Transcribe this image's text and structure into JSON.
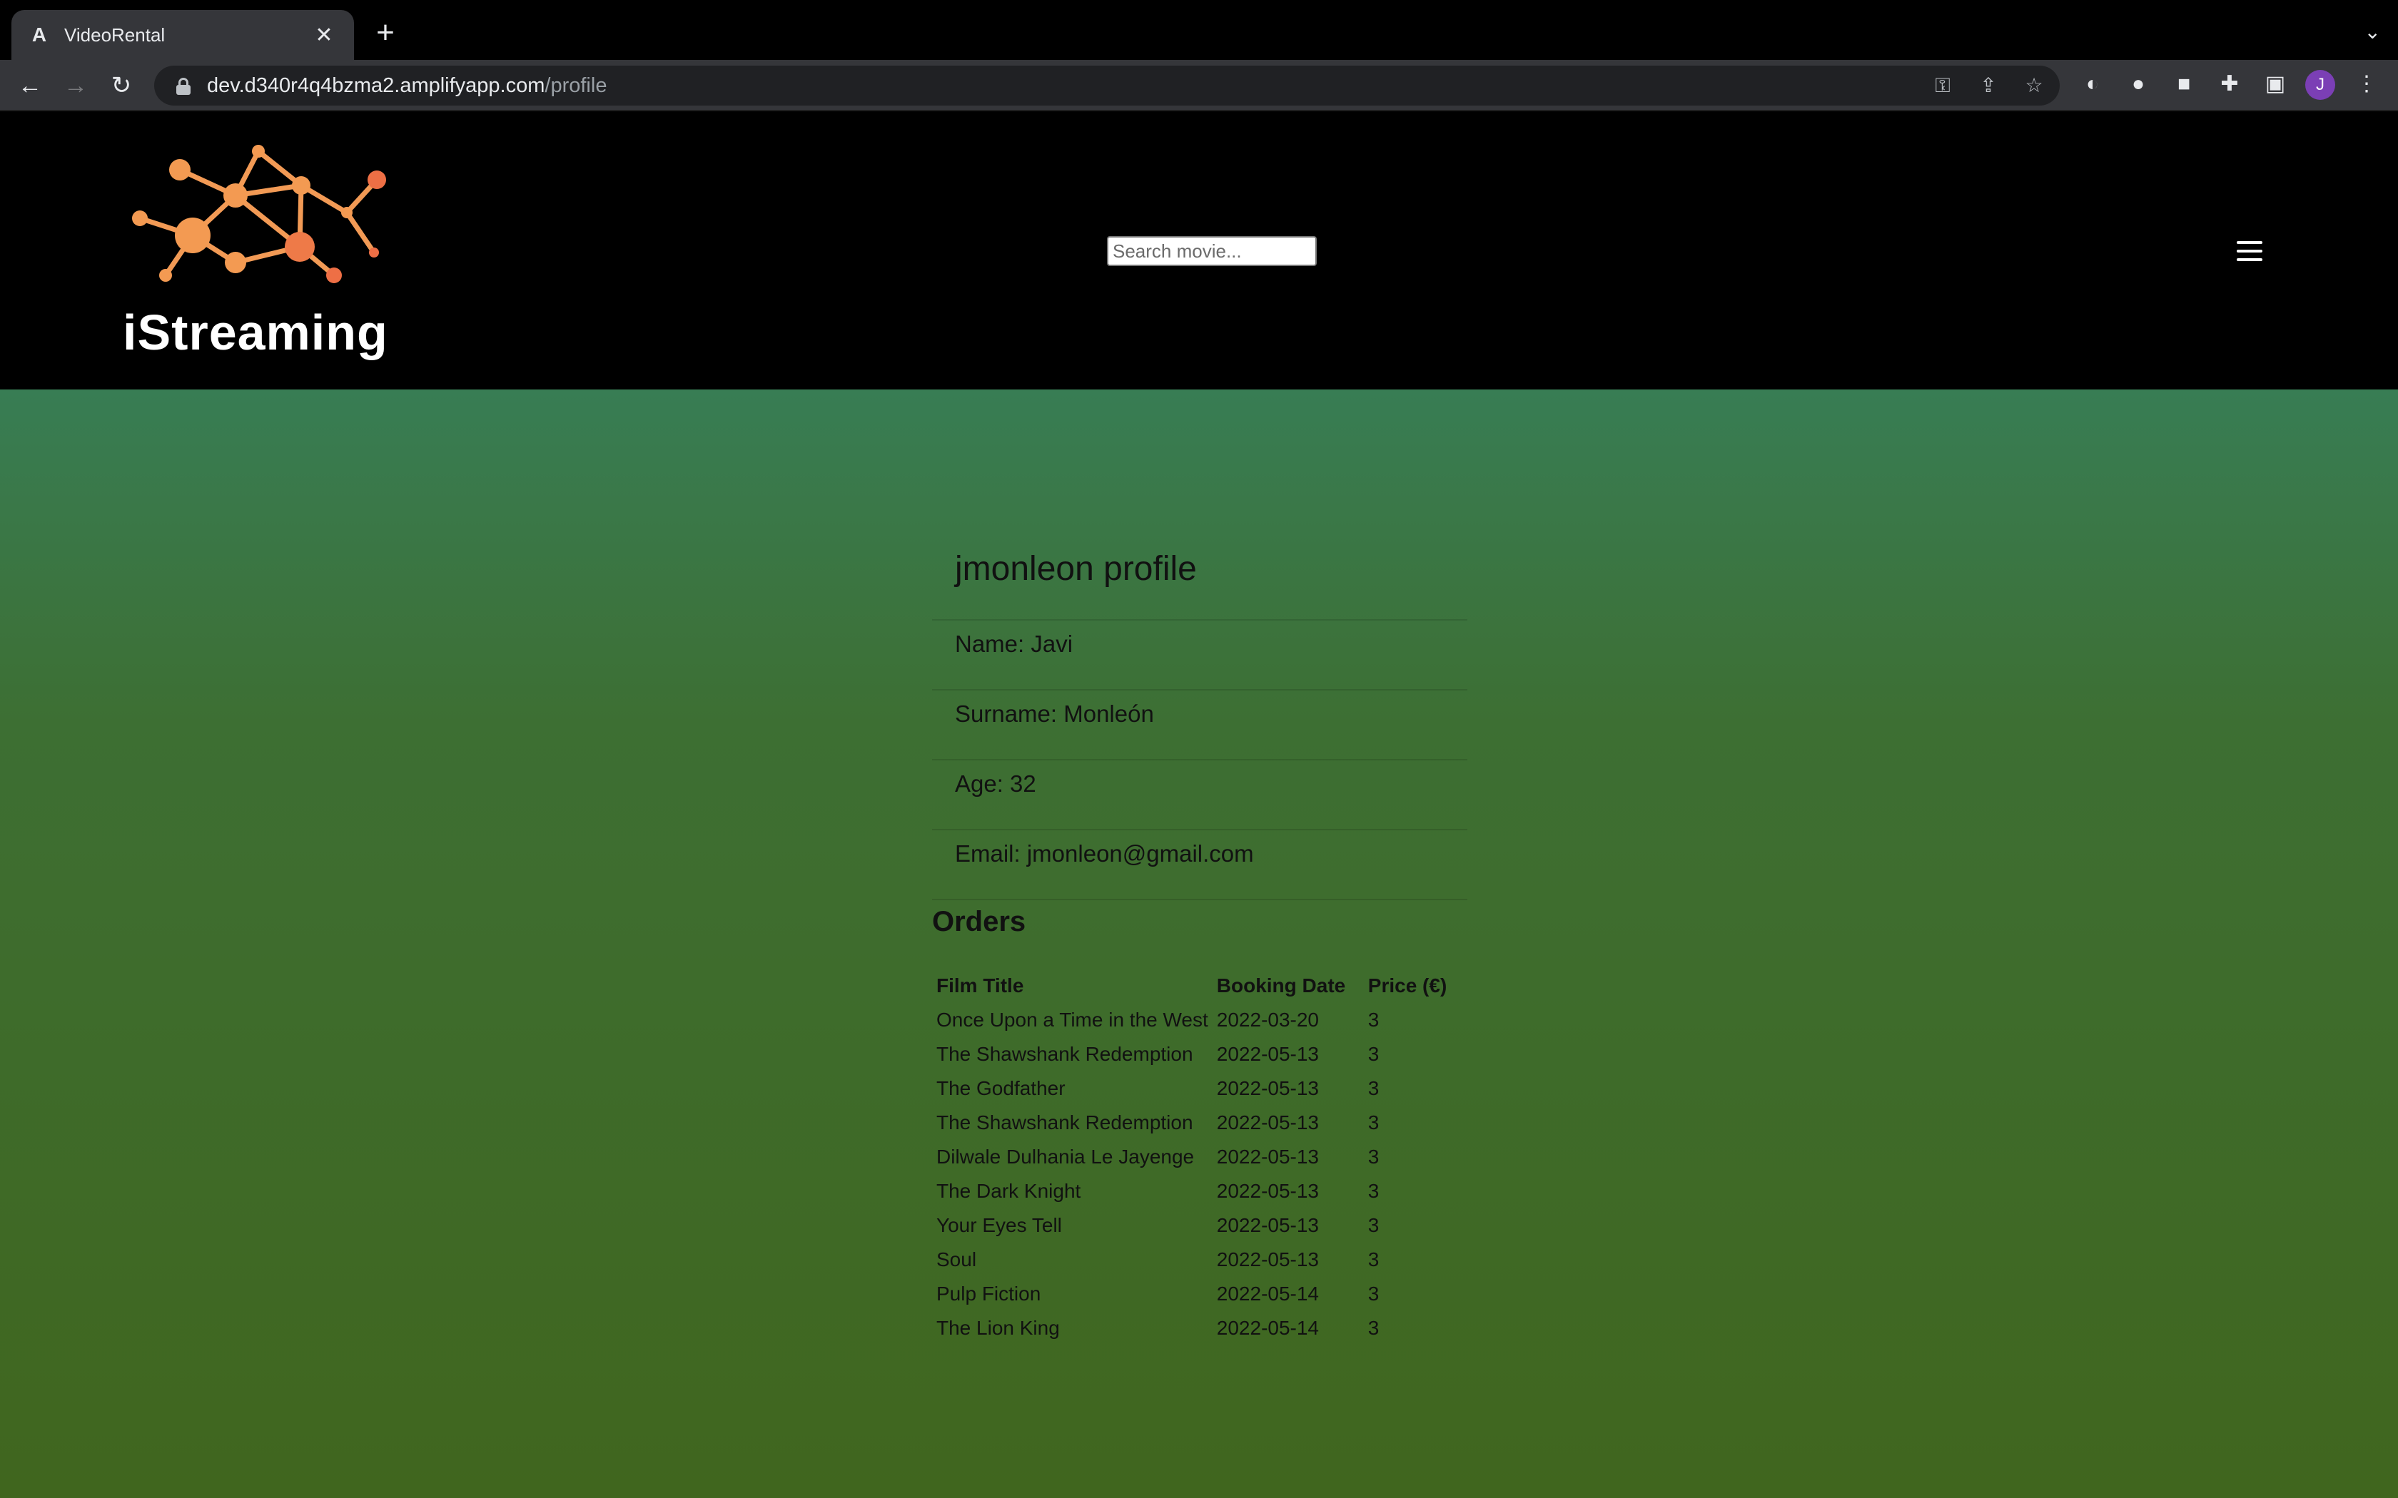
{
  "browser": {
    "tab_title": "VideoRental",
    "favicon": "A",
    "url_host": "dev.d340r4q4bzma2.amplifyapp.com",
    "url_path": "/profile",
    "profile_initial": "J"
  },
  "header": {
    "logo_text": "iStreaming",
    "search_placeholder": "Search movie..."
  },
  "profile": {
    "title": "jmonleon profile",
    "fields": [
      {
        "text": "Name: Javi"
      },
      {
        "text": "Surname: Monleón"
      },
      {
        "text": "Age: 32"
      },
      {
        "text": "Email: jmonleon@gmail.com"
      }
    ]
  },
  "orders": {
    "title": "Orders",
    "columns": [
      "Film Title",
      "Booking Date",
      "Price (€)"
    ],
    "rows": [
      {
        "title": "Once Upon a Time in the West",
        "date": "2022-03-20",
        "price": "3"
      },
      {
        "title": "The Shawshank Redemption",
        "date": "2022-05-13",
        "price": "3"
      },
      {
        "title": "The Godfather",
        "date": "2022-05-13",
        "price": "3"
      },
      {
        "title": "The Shawshank Redemption",
        "date": "2022-05-13",
        "price": "3"
      },
      {
        "title": "Dilwale Dulhania Le Jayenge",
        "date": "2022-05-13",
        "price": "3"
      },
      {
        "title": "The Dark Knight",
        "date": "2022-05-13",
        "price": "3"
      },
      {
        "title": "Your Eyes Tell",
        "date": "2022-05-13",
        "price": "3"
      },
      {
        "title": "Soul",
        "date": "2022-05-13",
        "price": "3"
      },
      {
        "title": "Pulp Fiction",
        "date": "2022-05-14",
        "price": "3"
      },
      {
        "title": "The Lion King",
        "date": "2022-05-14",
        "price": "3"
      }
    ]
  },
  "colors": {
    "logo_orange": "#f08a4b",
    "bg_top": "#387d54",
    "bg_bottom": "#40661e"
  }
}
